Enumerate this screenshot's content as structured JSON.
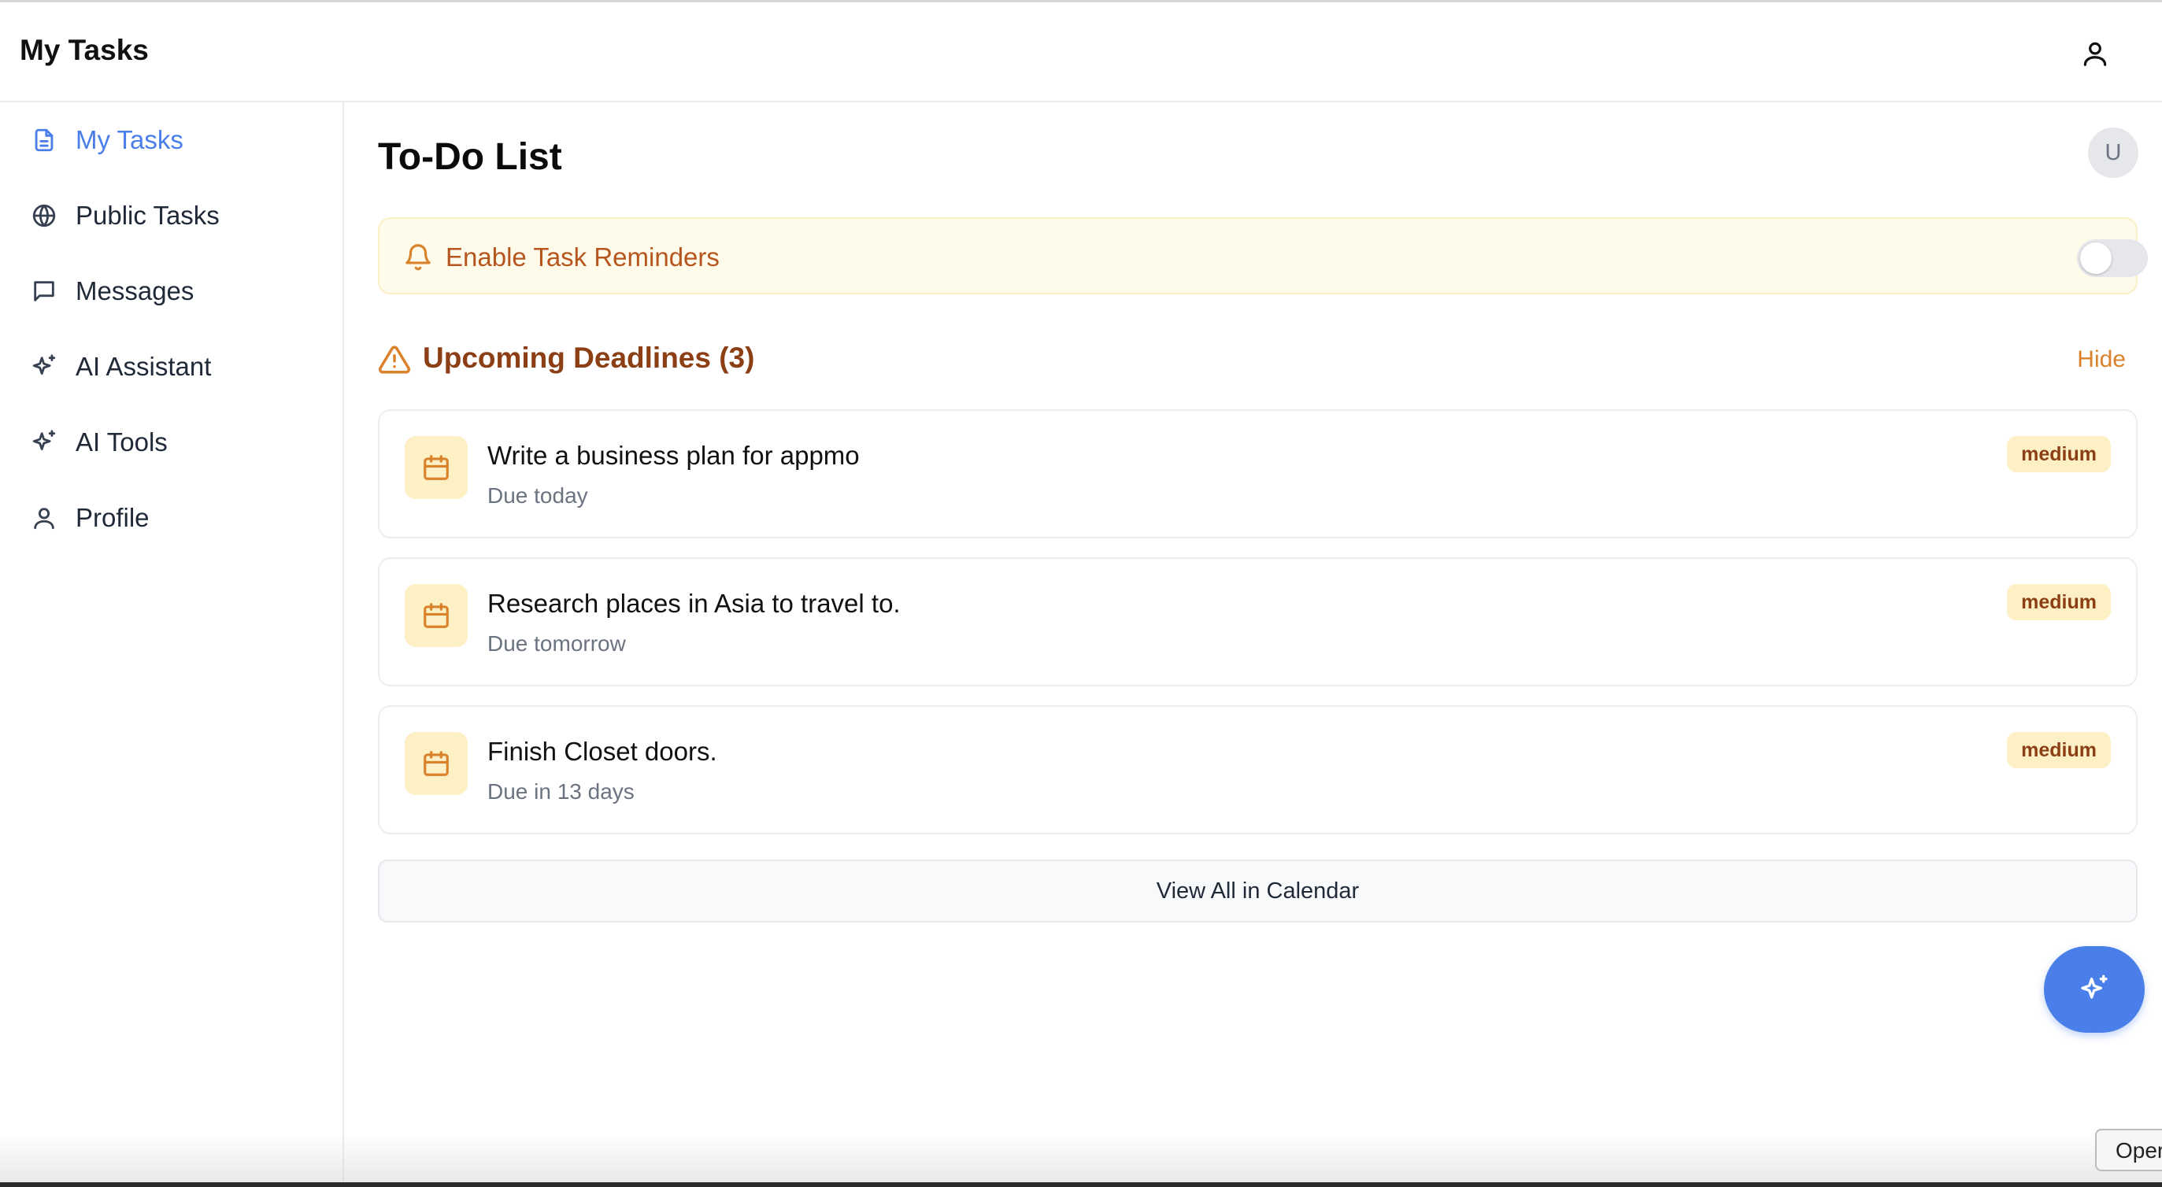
{
  "header": {
    "title": "My Tasks",
    "user_icon": "user-icon"
  },
  "sidebar": {
    "items": [
      {
        "label": "My Tasks",
        "icon": "document-icon",
        "active": true
      },
      {
        "label": "Public Tasks",
        "icon": "globe-icon",
        "active": false
      },
      {
        "label": "Messages",
        "icon": "message-icon",
        "active": false
      },
      {
        "label": "AI Assistant",
        "icon": "sparkles-icon",
        "active": false
      },
      {
        "label": "AI Tools",
        "icon": "sparkles-icon",
        "active": false
      },
      {
        "label": "Profile",
        "icon": "user-icon",
        "active": false
      }
    ]
  },
  "main": {
    "title": "To-Do List",
    "avatar_initial": "U",
    "reminders": {
      "label": "Enable Task Reminders",
      "enabled": false
    },
    "deadlines": {
      "title": "Upcoming Deadlines (3)",
      "hide_label": "Hide",
      "tasks": [
        {
          "title": "Write a business plan for appmo",
          "due": "Due today",
          "priority": "medium"
        },
        {
          "title": "Research places in Asia to travel to.",
          "due": "Due tomorrow",
          "priority": "medium"
        },
        {
          "title": "Finish Closet doors.",
          "due": "Due in 13 days",
          "priority": "medium"
        }
      ]
    },
    "view_calendar_label": "View All in Calendar"
  },
  "fab": {
    "icon": "sparkles-icon"
  },
  "tooltip": {
    "text": "Oper"
  },
  "colors": {
    "accent": "#4a7ee8",
    "warning_text": "#8c3f14",
    "warning_accent": "#d9822b",
    "banner_bg": "#fefbea",
    "badge_bg": "#fdf0c4"
  }
}
